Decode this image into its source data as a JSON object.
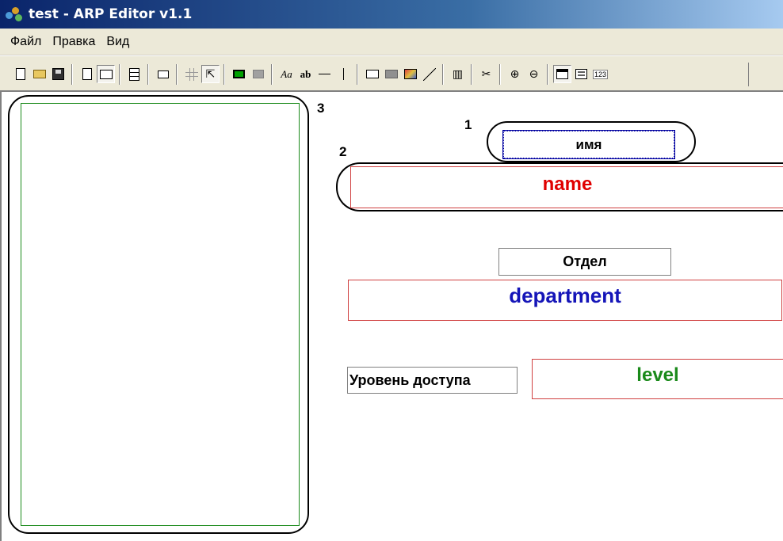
{
  "window": {
    "title": "test - ARP Editor v1.1",
    "icon": "app-icon"
  },
  "menu": {
    "items": [
      "Файл",
      "Правка",
      "Вид"
    ]
  },
  "toolbar": {
    "buttons": [
      "new-file-icon",
      "open-folder-icon",
      "save-disk-icon",
      "page-portrait-icon",
      "page-landscape-icon",
      "page-lines-icon",
      "small-rect-icon",
      "grid-icon",
      "snap-cursor-icon",
      "green-box-icon",
      "gray-box-icon",
      "text-label-icon",
      "text-field-icon",
      "horizontal-line-icon",
      "vertical-line-icon",
      "rect-outline-icon",
      "rect-filled-icon",
      "picture-icon",
      "diagonal-line-icon",
      "barcode-icon",
      "cut-icon",
      "zoom-in-icon",
      "zoom-out-icon",
      "window-icon",
      "properties-icon",
      "numbering-icon"
    ],
    "labels": {
      "text_label": "Aa",
      "text_field": "ab",
      "numbering": "123"
    }
  },
  "annotations": {
    "one": "1",
    "two": "2",
    "three": "3"
  },
  "fields": {
    "name_label": "имя",
    "name_value": "name",
    "department_label": "Отдел",
    "department_value": "department",
    "level_label": "Уровень доступа",
    "level_value": "level"
  },
  "colors": {
    "name_value": "#e00000",
    "department_value": "#1515b8",
    "level_value": "#1a8a1a",
    "field_border": "#d04040",
    "selection": "#0000a0",
    "card_border": "#1a8a1a"
  }
}
